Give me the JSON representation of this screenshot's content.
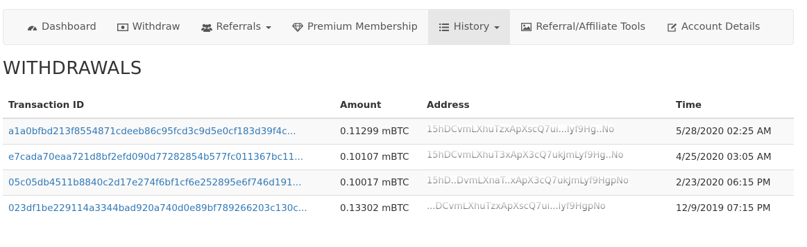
{
  "nav": {
    "items": [
      {
        "label": "Dashboard",
        "icon": "dashboard-icon",
        "dropdown": false,
        "active": false
      },
      {
        "label": "Withdraw",
        "icon": "money-icon",
        "dropdown": false,
        "active": false
      },
      {
        "label": "Referrals",
        "icon": "users-icon",
        "dropdown": true,
        "active": false
      },
      {
        "label": "Premium Membership",
        "icon": "diamond-icon",
        "dropdown": false,
        "active": false
      },
      {
        "label": "History",
        "icon": "list-icon",
        "dropdown": true,
        "active": true
      },
      {
        "label": "Referral/Affiliate Tools",
        "icon": "image-icon",
        "dropdown": false,
        "active": false
      },
      {
        "label": "Account Details",
        "icon": "edit-icon",
        "dropdown": false,
        "active": false
      }
    ]
  },
  "page": {
    "title": "WITHDRAWALS"
  },
  "table": {
    "headers": {
      "transaction_id": "Transaction ID",
      "amount": "Amount",
      "address": "Address",
      "time": "Time"
    },
    "rows": [
      {
        "tx": "a1a0bfbd213f8554871cdeeb86c95fcd3c9d5e0cf183d39f4c...",
        "amount": "0.11299 mBTC",
        "address": "15hDCvmLXhuTzxApXscQ7ui...lyf9Hg..No",
        "time": "5/28/2020 02:25 AM"
      },
      {
        "tx": "e7cada70eaa721d8bf2efd090d77282854b577fc011367bc11...",
        "amount": "0.10107 mBTC",
        "address": "15hDCvmLXhuT3xApX3cQ7ukJmLyf9Hg..No",
        "time": "4/25/2020 03:05 AM"
      },
      {
        "tx": "05c05db4511b8840c2d17e274f6bf1cf6e252895e6f746d191...",
        "amount": "0.10017 mBTC",
        "address": "15hD..DvmLXnaT..xApX3cQ7ukJmLyf9HgpNo",
        "time": "2/23/2020 06:15 PM"
      },
      {
        "tx": "023df1be229114a3344bad920a740d0e89bf789266203c130c...",
        "amount": "0.13302 mBTC",
        "address": "...DCvmLXhuTzxApXscQ7ui...lyf9HgpNo",
        "time": "12/9/2019 07:15 PM"
      }
    ]
  }
}
